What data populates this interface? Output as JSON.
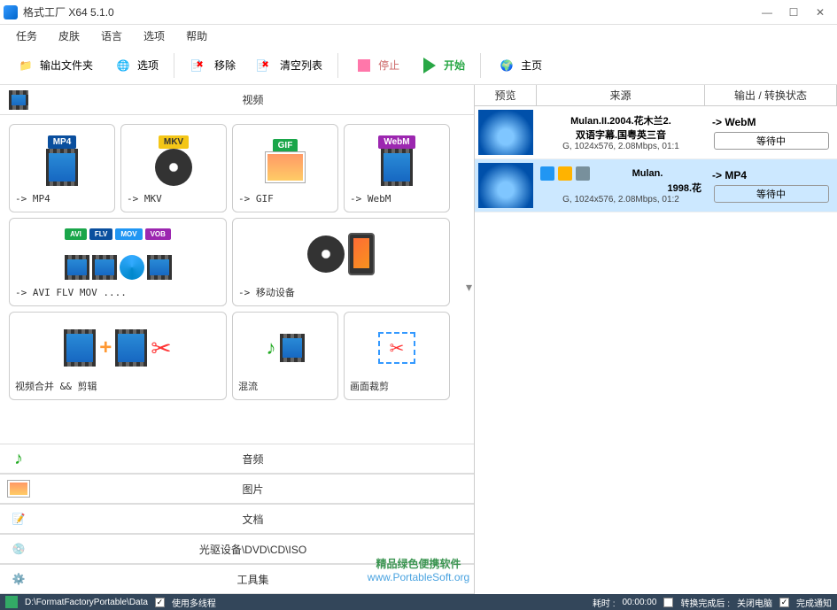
{
  "window": {
    "title": "格式工厂 X64 5.1.0"
  },
  "menu": {
    "task": "任务",
    "skin": "皮肤",
    "language": "语言",
    "option": "选项",
    "help": "帮助"
  },
  "toolbar": {
    "output_folder": "输出文件夹",
    "options": "选项",
    "remove": "移除",
    "clear": "清空列表",
    "stop": "停止",
    "start": "开始",
    "home": "主页"
  },
  "categories": {
    "video": "视频",
    "audio": "音频",
    "picture": "图片",
    "document": "文档",
    "rom": "光驱设备\\DVD\\CD\\ISO",
    "tools": "工具集"
  },
  "tiles": {
    "mp4": {
      "badge": "MP4",
      "label": "-> MP4",
      "color": "#0a4f9e"
    },
    "mkv": {
      "badge": "MKV",
      "label": "-> MKV",
      "color": "#f4c617"
    },
    "gif": {
      "badge": "GIF",
      "label": "-> GIF",
      "color": "#1aa64a"
    },
    "webm": {
      "badge": "WebM",
      "label": "-> WebM",
      "color": "#9c27b0"
    },
    "multi": {
      "badges": [
        "AVI",
        "FLV",
        "MOV",
        "VOB"
      ],
      "colors": [
        "#1aa64a",
        "#0a4f9e",
        "#2196f3",
        "#9c27b0"
      ],
      "label": "-> AVI FLV MOV ...."
    },
    "mobile": {
      "label": "-> 移动设备"
    },
    "merge": {
      "label": "视频合并 && 剪辑"
    },
    "mux": {
      "label": "混流"
    },
    "crop": {
      "label": "画面裁剪"
    }
  },
  "queue_head": {
    "preview": "预览",
    "source": "来源",
    "output": "输出 / 转换状态"
  },
  "queue": [
    {
      "name": "Mulan.II.2004.花木兰2.",
      "sub": "双语字幕.国粤英三音",
      "meta": "G, 1024x576, 2.08Mbps, 01:1",
      "target": "-> WebM",
      "status": "等待中"
    },
    {
      "name": "Mulan.",
      "sub": "1998.花",
      "meta": "G, 1024x576, 2.08Mbps, 01:2",
      "target": "-> MP4",
      "status": "等待中",
      "selected": true
    }
  ],
  "status": {
    "path": "D:\\FormatFactoryPortable\\Data",
    "multithread": "使用多线程",
    "elapsed_label": "耗时 :",
    "elapsed_value": "00:00:00",
    "after_label": "转换完成后 :",
    "after_value": "关闭电脑",
    "notify": "完成通知"
  },
  "watermark": {
    "line1": "精品绿色便携软件",
    "line2": "www.PortableSoft.org"
  }
}
